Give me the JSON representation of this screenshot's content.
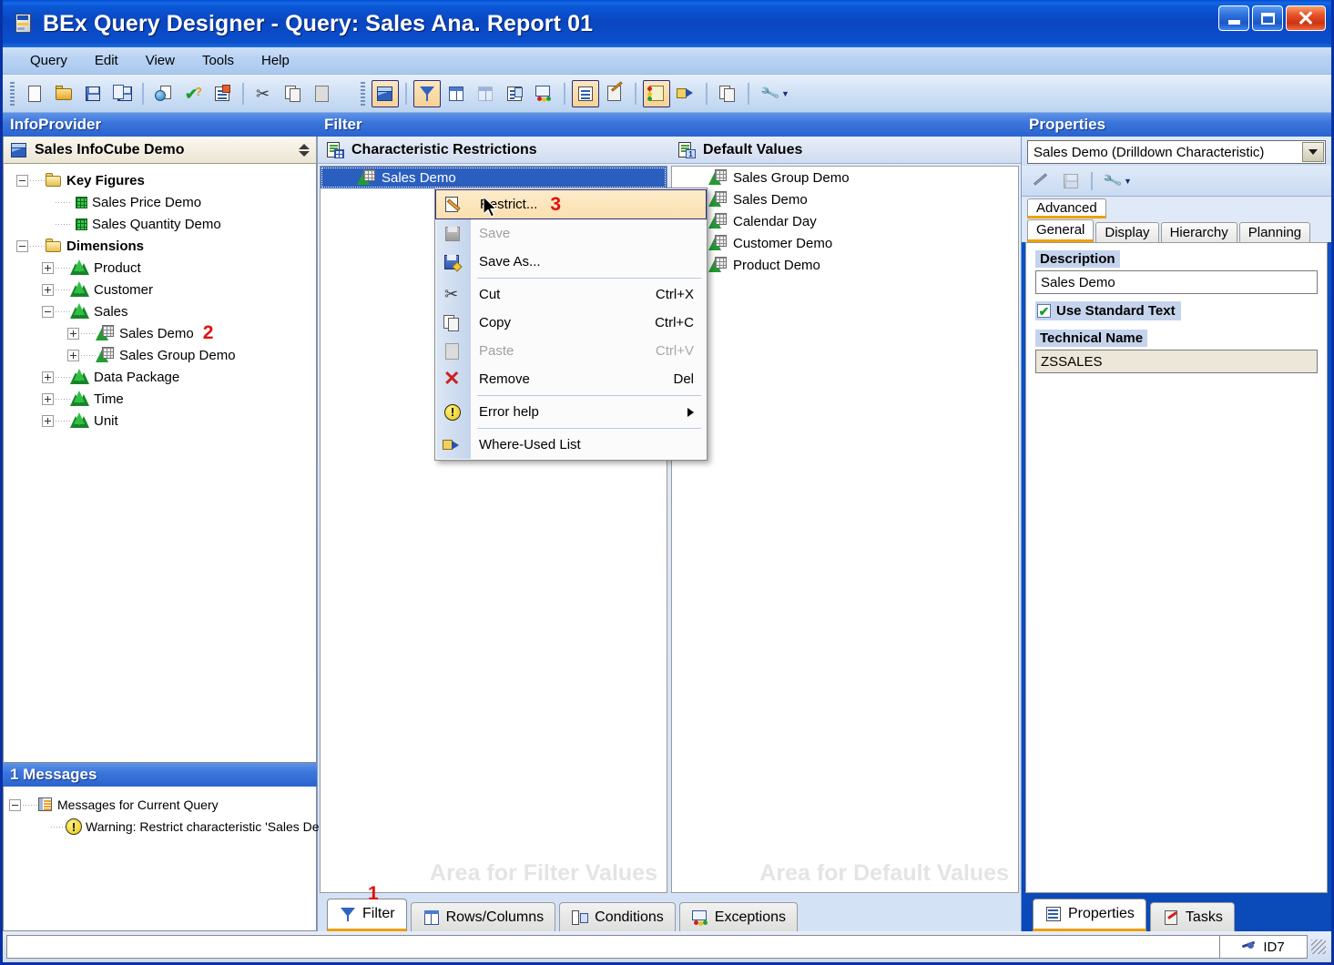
{
  "window": {
    "title": "BEx Query Designer - Query: Sales Ana. Report 01",
    "icon": "app-icon",
    "minimize_label": "Minimize",
    "maximize_label": "Maximize",
    "close_label": "Close"
  },
  "menubar": {
    "items": [
      {
        "label": "Query"
      },
      {
        "label": "Edit"
      },
      {
        "label": "View"
      },
      {
        "label": "Tools"
      },
      {
        "label": "Help"
      }
    ]
  },
  "toolbar": {
    "group1": [
      {
        "name": "new-query-icon",
        "label": "New Query"
      },
      {
        "name": "open-query-icon",
        "label": "Open Query"
      },
      {
        "name": "save-query-icon",
        "label": "Save Query"
      },
      {
        "name": "save-as-query-icon",
        "label": "Save As"
      },
      {
        "name": "publish-web-icon",
        "label": "Publish"
      },
      {
        "name": "check-query-icon",
        "label": "Check Query"
      },
      {
        "name": "query-properties-icon",
        "label": "Query Properties"
      },
      {
        "name": "cut-icon",
        "label": "Cut"
      },
      {
        "name": "copy-icon",
        "label": "Copy"
      },
      {
        "name": "paste-icon",
        "label": "Paste"
      }
    ],
    "group2": [
      {
        "name": "infoprovider-cube-icon",
        "label": "InfoProvider",
        "active": true
      },
      {
        "name": "filter-funnel-icon",
        "label": "Filter",
        "active": true
      },
      {
        "name": "rows-columns-icon",
        "label": "Rows/Columns",
        "active": false
      },
      {
        "name": "cell-editor-icon",
        "label": "Cell Editor",
        "active": false
      },
      {
        "name": "conditions-icon",
        "label": "Conditions",
        "active": false
      },
      {
        "name": "exceptions-icon",
        "label": "Exceptions",
        "active": false
      },
      {
        "name": "properties-list-icon",
        "label": "Properties",
        "active": true
      },
      {
        "name": "tasks-icon",
        "label": "Tasks",
        "active": false
      },
      {
        "name": "messages-icon",
        "label": "Messages",
        "active": true
      },
      {
        "name": "where-used-icon",
        "label": "Where-Used List",
        "active": false
      },
      {
        "name": "documents-icon",
        "label": "Documents",
        "active": false
      },
      {
        "name": "settings-wrench-icon",
        "label": "Settings",
        "active": false
      }
    ]
  },
  "infoprovider": {
    "panel_title": "InfoProvider",
    "cube_name": "Sales InfoCube Demo",
    "tree": [
      {
        "label": "Key Figures",
        "level": 0,
        "icon": "folder-icon",
        "expander": "minus",
        "bold": true
      },
      {
        "label": "Sales Price Demo",
        "level": 1,
        "icon": "key-figure-icon",
        "expander": "none",
        "bold": false
      },
      {
        "label": "Sales Quantity Demo",
        "level": 1,
        "icon": "key-figure-icon",
        "expander": "none",
        "bold": false
      },
      {
        "label": "Dimensions",
        "level": 0,
        "icon": "folder-icon",
        "expander": "minus",
        "bold": true
      },
      {
        "label": "Product",
        "level": 1,
        "icon": "dimension-icon",
        "expander": "plus",
        "bold": false
      },
      {
        "label": "Customer",
        "level": 1,
        "icon": "dimension-icon",
        "expander": "plus",
        "bold": false
      },
      {
        "label": "Sales",
        "level": 1,
        "icon": "dimension-icon",
        "expander": "minus",
        "bold": false
      },
      {
        "label": "Sales Demo",
        "level": 2,
        "icon": "characteristic-icon",
        "expander": "plus",
        "bold": false,
        "marker": "2"
      },
      {
        "label": "Sales Group Demo",
        "level": 2,
        "icon": "characteristic-icon",
        "expander": "plus",
        "bold": false
      },
      {
        "label": "Data Package",
        "level": 1,
        "icon": "dimension-icon",
        "expander": "plus",
        "bold": false
      },
      {
        "label": "Time",
        "level": 1,
        "icon": "dimension-icon",
        "expander": "plus",
        "bold": false
      },
      {
        "label": "Unit",
        "level": 1,
        "icon": "dimension-icon",
        "expander": "plus",
        "bold": false
      }
    ]
  },
  "messages": {
    "panel_title": "1 Messages",
    "root_label": "Messages for Current Query",
    "items": [
      {
        "text": "Warning: Restrict characteristic 'Sales Demo' in the filter, otherwise it will be ignored"
      }
    ]
  },
  "filter": {
    "panel_title": "Filter",
    "characteristic_restrictions": {
      "header": "Characteristic Restrictions",
      "items": [
        {
          "label": "Sales Demo",
          "selected": true
        }
      ],
      "watermark": "Area for Filter Values"
    },
    "default_values": {
      "header": "Default Values",
      "items": [
        {
          "label": "Sales Group Demo"
        },
        {
          "label": "Sales Demo"
        },
        {
          "label": "Calendar Day"
        },
        {
          "label": "Customer Demo"
        },
        {
          "label": "Product Demo"
        }
      ],
      "watermark": "Area for Default Values"
    },
    "tabs": [
      {
        "label": "Filter",
        "icon": "filter-funnel-icon",
        "active": true,
        "marker": "1"
      },
      {
        "label": "Rows/Columns",
        "icon": "rows-columns-icon",
        "active": false
      },
      {
        "label": "Conditions",
        "icon": "conditions-icon",
        "active": false
      },
      {
        "label": "Exceptions",
        "icon": "exceptions-icon",
        "active": false
      }
    ]
  },
  "context_menu": {
    "marker": "3",
    "items": [
      {
        "label": "Restrict...",
        "icon": "restrict-pencil-icon",
        "shortcut": "",
        "state": "highlight"
      },
      {
        "label": "Save",
        "icon": "save-icon",
        "shortcut": "",
        "state": "disabled"
      },
      {
        "label": "Save As...",
        "icon": "save-as-icon",
        "shortcut": "",
        "state": "normal"
      },
      {
        "separator": true
      },
      {
        "label": "Cut",
        "icon": "cut-scissors-icon",
        "shortcut": "Ctrl+X",
        "state": "normal"
      },
      {
        "label": "Copy",
        "icon": "copy-icon",
        "shortcut": "Ctrl+C",
        "state": "normal"
      },
      {
        "label": "Paste",
        "icon": "paste-icon",
        "shortcut": "Ctrl+V",
        "state": "disabled"
      },
      {
        "label": "Remove",
        "icon": "remove-x-icon",
        "shortcut": "Del",
        "state": "normal"
      },
      {
        "separator": true
      },
      {
        "label": "Error help",
        "icon": "error-help-icon",
        "shortcut": "",
        "state": "submenu"
      },
      {
        "separator": true
      },
      {
        "label": "Where-Used List",
        "icon": "where-used-icon",
        "shortcut": "",
        "state": "normal"
      }
    ]
  },
  "properties": {
    "panel_title": "Properties",
    "selector_value": "Sales Demo (Drilldown Characteristic)",
    "toolbar": [
      {
        "name": "edit-pencil-icon",
        "label": "Edit"
      },
      {
        "name": "save-disk-icon",
        "label": "Save"
      },
      {
        "name": "settings-wrench-icon",
        "label": "Settings"
      }
    ],
    "advanced_tab": {
      "label": "Advanced",
      "active": true
    },
    "tabs": [
      {
        "label": "General",
        "active": true
      },
      {
        "label": "Display",
        "active": false
      },
      {
        "label": "Hierarchy",
        "active": false
      },
      {
        "label": "Planning",
        "active": false
      }
    ],
    "fields": {
      "description_label": "Description",
      "description_value": "Sales Demo",
      "use_standard_text_label": "Use Standard Text",
      "use_standard_text_checked": true,
      "technical_name_label": "Technical Name",
      "technical_name_value": "ZSSALES"
    },
    "bottom_tabs": [
      {
        "label": "Properties",
        "icon": "properties-list-icon",
        "active": true
      },
      {
        "label": "Tasks",
        "icon": "tasks-clipboard-icon",
        "active": false
      }
    ]
  },
  "statusbar": {
    "message": "",
    "system_id": "ID7",
    "system_icon": "connection-icon"
  },
  "colors": {
    "titlebar_blue": "#0b55c4",
    "panel_header_blue": "#2a63cf",
    "selection_blue": "#2b5fbf",
    "highlight_orange": "#fbdfae",
    "active_tab_underline": "#f0a000",
    "marker_red": "#e01010",
    "label_bg": "#c5d4ec",
    "readonly_bg": "#ece7d8"
  }
}
